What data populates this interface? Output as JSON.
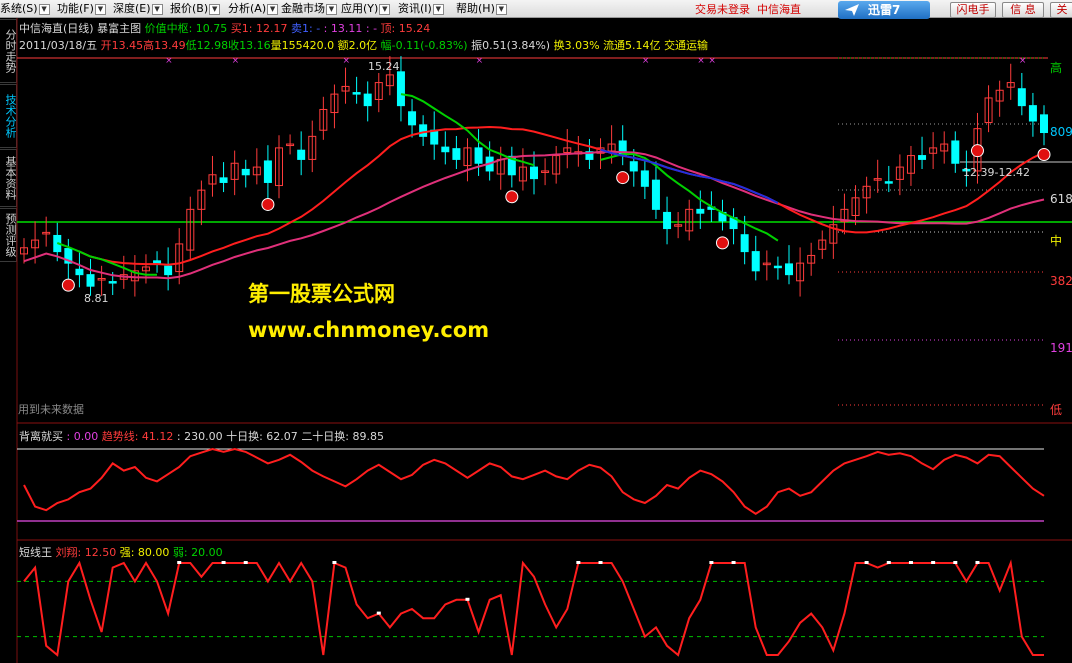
{
  "menu": [
    "系统(S)",
    "功能(F)",
    "深度(E)",
    "报价(B)",
    "分析(A)",
    "金融市场",
    "应用(Y)",
    "资讯(I)",
    "帮助(H)"
  ],
  "trade_status": "交易未登录",
  "trade_stock": "中信海直",
  "xunlei": "迅雷7",
  "toolbar": {
    "flash": "闪电手",
    "info": "信 息",
    "close": "关 闭"
  },
  "side_tabs": [
    "分时走势",
    "技术分析",
    "基本资料",
    "预测评级"
  ],
  "indicator_line": {
    "name": "中信海直(日线)",
    "title": "暴富主图",
    "center_label": "价值中枢: 10.75",
    "buy1": "买1: 12.17",
    "buy1b": "卖1: -",
    "buy2": ": 13.11 : -",
    "top": "顶: 15.24"
  },
  "quote_line": {
    "date": "2011/03/18/五",
    "open": "开13.45",
    "high": "高13.49",
    "low": "低12.98",
    "close": "收13.16",
    "volume": "量155420.0",
    "amount": "额2.0亿",
    "change": "幅-0.11(-0.83%)",
    "amplitude": "振0.51(3.84%)",
    "turnover": "换3.03%",
    "float_cap": "流通5.14亿",
    "industry": "交通运输"
  },
  "chart_labels": {
    "peak": "15.24",
    "trough": "8.81",
    "range": "12.39-12.42"
  },
  "right_labels": {
    "high": "高",
    "l809": "809",
    "l618": "618",
    "mid": "中",
    "l382": "382",
    "l191": "191",
    "low": "低"
  },
  "watermark": {
    "line1": "第一股票公式网",
    "line2": "www.chnmoney.com"
  },
  "future_note": "用到未来数据",
  "panel2": {
    "name": "背离就买",
    "v1": ": 0.00",
    "trend_label": "趋势线: 41.12",
    "v2": ": 230.00",
    "ten_day": "十日换: 62.07",
    "twenty_day": "二十日换: 89.85"
  },
  "panel3": {
    "name": "短线王",
    "liu": "刘翔: 12.50",
    "strong": "强: 80.00",
    "weak": "弱: 20.00"
  },
  "colors": {
    "up": "#ff3c3c",
    "down": "#00ffff",
    "ma_green": "#00d000",
    "ma_blue": "#2030e0",
    "ma_pink": "#e0307a",
    "ma_red": "#ff1e1e"
  },
  "chart_data": [
    {
      "type": "candlestick",
      "series_close": [
        10.3,
        10.5,
        10.7,
        10.2,
        9.9,
        9.6,
        9.3,
        9.5,
        9.4,
        9.6,
        9.7,
        9.8,
        9.9,
        9.6,
        10.4,
        11.3,
        11.8,
        12.2,
        12.0,
        12.5,
        12.2,
        12.4,
        12.0,
        12.9,
        13.0,
        12.6,
        13.2,
        13.9,
        14.3,
        14.5,
        14.3,
        14.0,
        14.6,
        14.8,
        14.0,
        13.5,
        13.2,
        13.0,
        12.8,
        12.6,
        12.9,
        12.5,
        12.3,
        12.6,
        12.2,
        12.4,
        12.1,
        12.3,
        12.7,
        12.9,
        12.8,
        12.6,
        12.9,
        13.0,
        12.7,
        12.3,
        11.9,
        11.3,
        10.8,
        10.9,
        11.3,
        11.2,
        11.3,
        11.0,
        10.8,
        10.2,
        9.7,
        9.9,
        9.8,
        9.6,
        9.9,
        10.1,
        10.5,
        10.9,
        11.3,
        11.6,
        11.9,
        12.1,
        12.0,
        12.4,
        12.7,
        12.6,
        12.9,
        13.0,
        12.5,
        12.3,
        13.4,
        14.2,
        14.4,
        14.6,
        14.0,
        13.6,
        13.3
      ],
      "ma_lines": [
        "green",
        "blue",
        "pink",
        "red"
      ],
      "y_levels": {
        "top": 15.24,
        "bottom": 8.81
      }
    },
    {
      "type": "line",
      "name": "背离就买",
      "series": [
        {
          "name": "趋势线",
          "values": [
            50,
            20,
            15,
            25,
            30,
            40,
            45,
            60,
            80,
            70,
            75,
            60,
            55,
            65,
            75,
            90,
            95,
            100,
            96,
            100,
            96,
            88,
            80,
            85,
            92,
            82,
            70,
            62,
            55,
            48,
            58,
            70,
            78,
            68,
            58,
            64,
            78,
            85,
            80,
            70,
            60,
            70,
            80,
            75,
            62,
            58,
            64,
            70,
            62,
            58,
            70,
            78,
            74,
            62,
            40,
            30,
            25,
            35,
            50,
            45,
            60,
            70,
            65,
            55,
            40,
            20,
            10,
            20,
            40,
            45,
            35,
            40,
            55,
            70,
            80,
            85,
            90,
            96,
            92,
            94,
            90,
            80,
            72,
            85,
            92,
            88,
            80,
            92,
            90,
            75,
            60,
            45,
            35
          ]
        }
      ],
      "ylim": [
        0,
        100
      ],
      "levels": [
        100,
        0
      ]
    },
    {
      "type": "line",
      "name": "短线王",
      "series": [
        {
          "name": "刘翔",
          "values": [
            80,
            95,
            10,
            0,
            80,
            100,
            60,
            25,
            95,
            100,
            80,
            100,
            80,
            45,
            100,
            100,
            85,
            100,
            100,
            100,
            100,
            100,
            80,
            100,
            80,
            100,
            80,
            0,
            100,
            95,
            55,
            40,
            45,
            30,
            45,
            50,
            40,
            40,
            55,
            60,
            60,
            25,
            60,
            65,
            0,
            100,
            85,
            55,
            30,
            50,
            100,
            100,
            100,
            100,
            80,
            50,
            20,
            30,
            10,
            0,
            40,
            60,
            100,
            100,
            100,
            100,
            30,
            0,
            0,
            15,
            35,
            45,
            30,
            5,
            45,
            100,
            100,
            95,
            100,
            100,
            100,
            100,
            100,
            100,
            100,
            80,
            100,
            100,
            70,
            100,
            20,
            0,
            0
          ]
        }
      ],
      "ylim": [
        0,
        100
      ],
      "levels": [
        80,
        20
      ]
    }
  ]
}
